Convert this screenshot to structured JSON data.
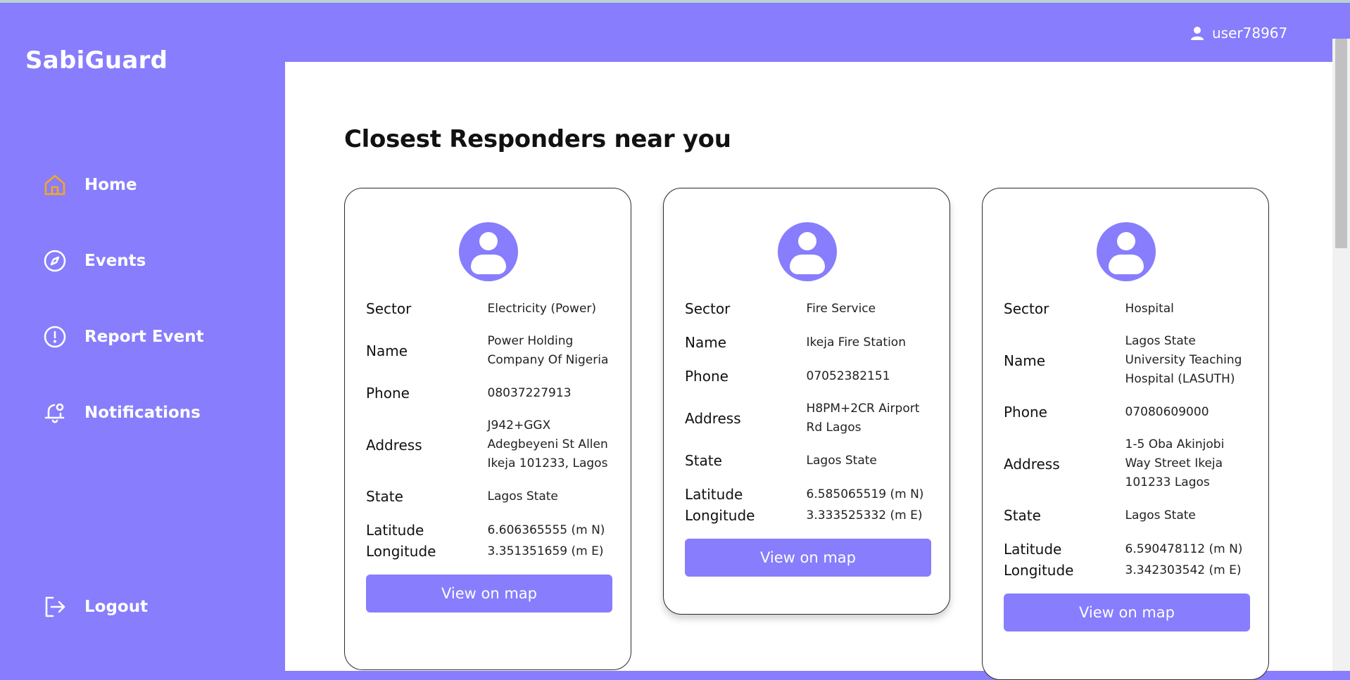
{
  "app": {
    "name": "SabiGuard"
  },
  "user": {
    "name": "user78967",
    "icon": "user-icon"
  },
  "nav": [
    {
      "label": "Home",
      "icon": "home-icon",
      "active": true
    },
    {
      "label": "Events",
      "icon": "compass-icon"
    },
    {
      "label": "Report Event",
      "icon": "alert-circle-icon"
    },
    {
      "label": "Notifications",
      "icon": "bell-icon"
    },
    {
      "label": "Logout",
      "icon": "logout-icon"
    }
  ],
  "page": {
    "title": "Closest Responders near you"
  },
  "labels": {
    "sector": "Sector",
    "name": "Name",
    "phone": "Phone",
    "address": "Address",
    "state": "State",
    "latitude": "Latitude",
    "longitude": "Longitude",
    "view_map": "View on map"
  },
  "responders": [
    {
      "sector": "Electricity (Power)",
      "name": "Power Holding Company Of Nigeria",
      "phone": "08037227913",
      "address": "J942+GGX Adegbeyeni St Allen Ikeja 101233, Lagos",
      "state": "Lagos State",
      "latitude": "6.606365555 (m N)",
      "longitude": "3.351351659 (m E)"
    },
    {
      "sector": "Fire Service",
      "name": "Ikeja Fire Station",
      "phone": "07052382151",
      "address": "H8PM+2CR Airport Rd Lagos",
      "state": "Lagos State",
      "latitude": "6.585065519 (m N)",
      "longitude": "3.333525332 (m E)"
    },
    {
      "sector": "Hospital",
      "name": "Lagos State University Teaching Hospital (LASUTH)",
      "phone": "07080609000",
      "address": "1-5 Oba Akinjobi Way Street Ikeja 101233 Lagos",
      "state": "Lagos State",
      "latitude": "6.590478112 (m N)",
      "longitude": "3.342303542 (m E)"
    }
  ],
  "colors": {
    "primary": "#877dfd",
    "active_icon": "#f5a623",
    "surface": "#ffffff"
  }
}
